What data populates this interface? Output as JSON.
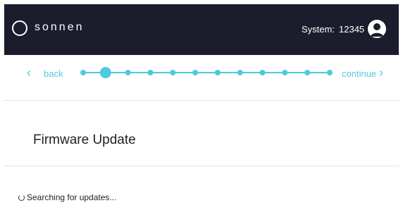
{
  "header": {
    "logo_text": "sonnen",
    "system_label": "System:",
    "system_value": "12345",
    "avatar_icon": "user-avatar-icon"
  },
  "nav": {
    "back_label": "back",
    "continue_label": "continue",
    "back_icon": "chevron-left-icon",
    "continue_icon": "chevron-right-icon",
    "steps_total": 12,
    "current_step": 2,
    "accent_color": "#4fc9e0"
  },
  "main": {
    "title": "Firmware Update",
    "status_text": "Searching for updates...",
    "status_icon": "spinner-icon"
  },
  "colors": {
    "header_bg": "#1b1d2c",
    "accent": "#4fc9e0",
    "text": "#222222"
  }
}
